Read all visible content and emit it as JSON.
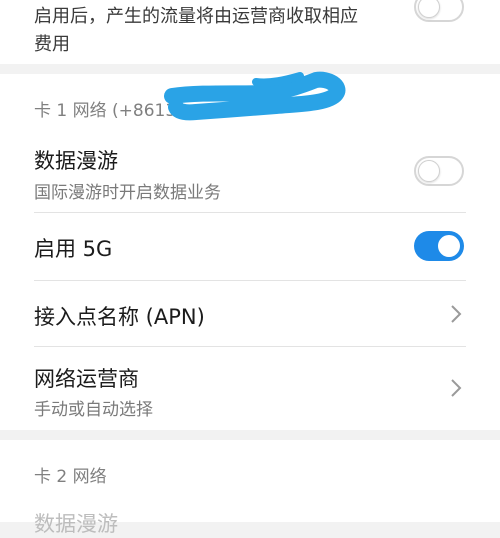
{
  "top_partial": {
    "description_line1": "启用后，产生的流量将由运营商收取相应",
    "description_line2": "费用",
    "toggle_state": "off"
  },
  "sim1": {
    "section_label": "卡 1 网络 (+8613",
    "roaming": {
      "title": "数据漫游",
      "subtitle": "国际漫游时开启数据业务",
      "toggle_state": "off"
    },
    "enable_5g": {
      "title": "启用 5G",
      "toggle_state": "on"
    },
    "apn": {
      "title": "接入点名称 (APN)"
    },
    "carrier": {
      "title": "网络运营商",
      "subtitle": "手动或自动选择"
    }
  },
  "sim2": {
    "section_label": "卡 2 网络",
    "roaming": {
      "title": "数据漫游"
    }
  },
  "colors": {
    "accent": "#1e8ae8",
    "redaction": "#2aa3e6",
    "background": "#f2f2f2",
    "card": "#ffffff"
  },
  "icons": {
    "chevron": "chevron-right-icon"
  }
}
